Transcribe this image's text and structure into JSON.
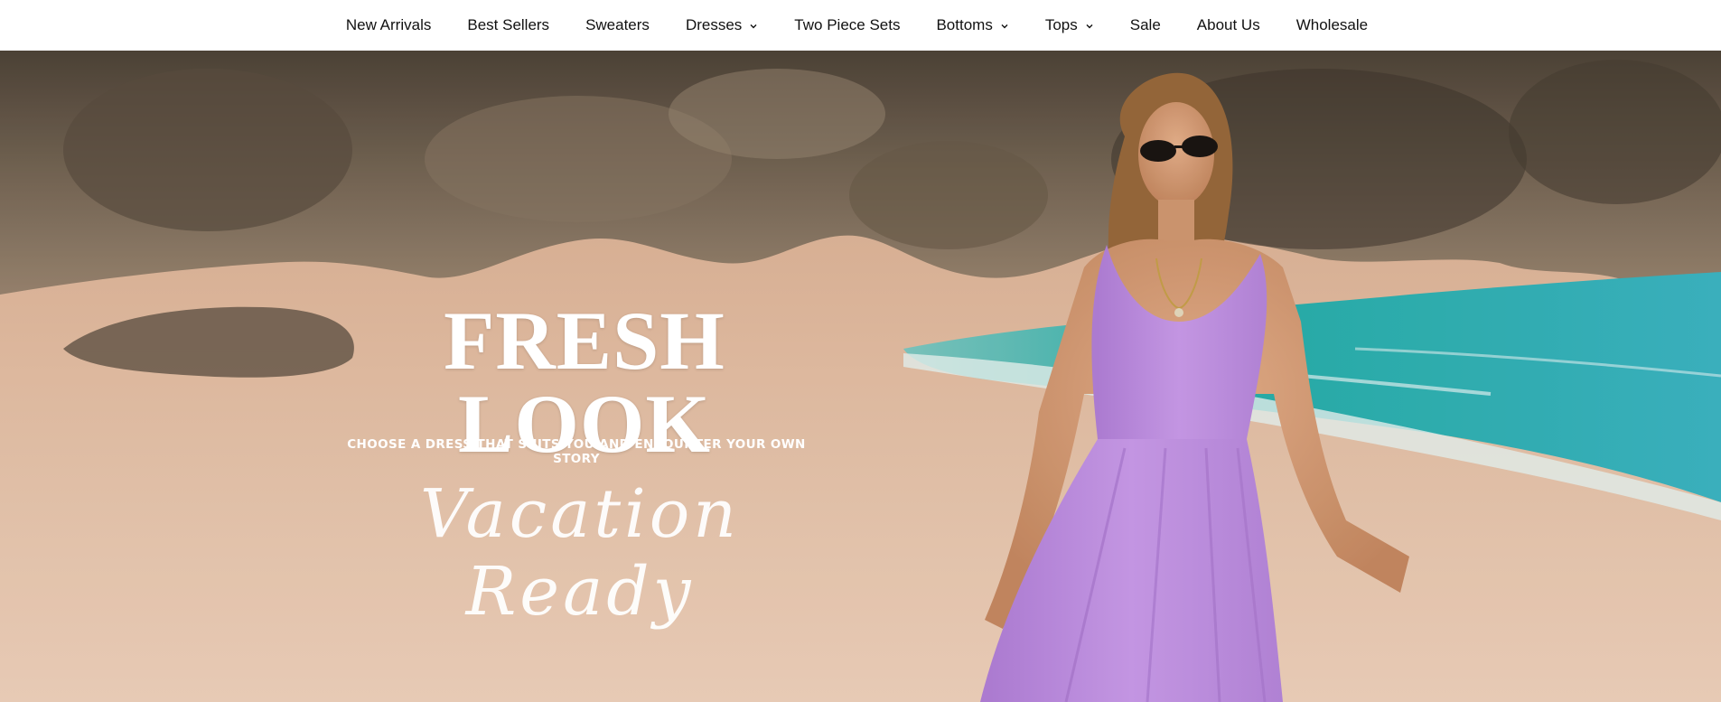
{
  "nav": {
    "items": [
      {
        "label": "New Arrivals",
        "has_dropdown": false
      },
      {
        "label": "Best Sellers",
        "has_dropdown": false
      },
      {
        "label": "Sweaters",
        "has_dropdown": false
      },
      {
        "label": "Dresses",
        "has_dropdown": true
      },
      {
        "label": "Two Piece Sets",
        "has_dropdown": false
      },
      {
        "label": "Bottoms",
        "has_dropdown": true
      },
      {
        "label": "Tops",
        "has_dropdown": true
      },
      {
        "label": "Sale",
        "has_dropdown": false
      },
      {
        "label": "About Us",
        "has_dropdown": false
      },
      {
        "label": "Wholesale",
        "has_dropdown": false
      }
    ],
    "dropdown_icon": "chevron-down-icon"
  },
  "hero": {
    "headline": "FRESH LOOK",
    "subheadline": "CHOOSE A DRESS THAT SUITS YOU AND ENCOUNTER YOUR OWN STORY",
    "script_text": "Vacation Ready",
    "colors": {
      "text": "#ffffff",
      "sand": "#e7c3a8",
      "rock": "#6e5f4f",
      "sea": "#2bb4b0",
      "dress": "#c597e6"
    }
  }
}
